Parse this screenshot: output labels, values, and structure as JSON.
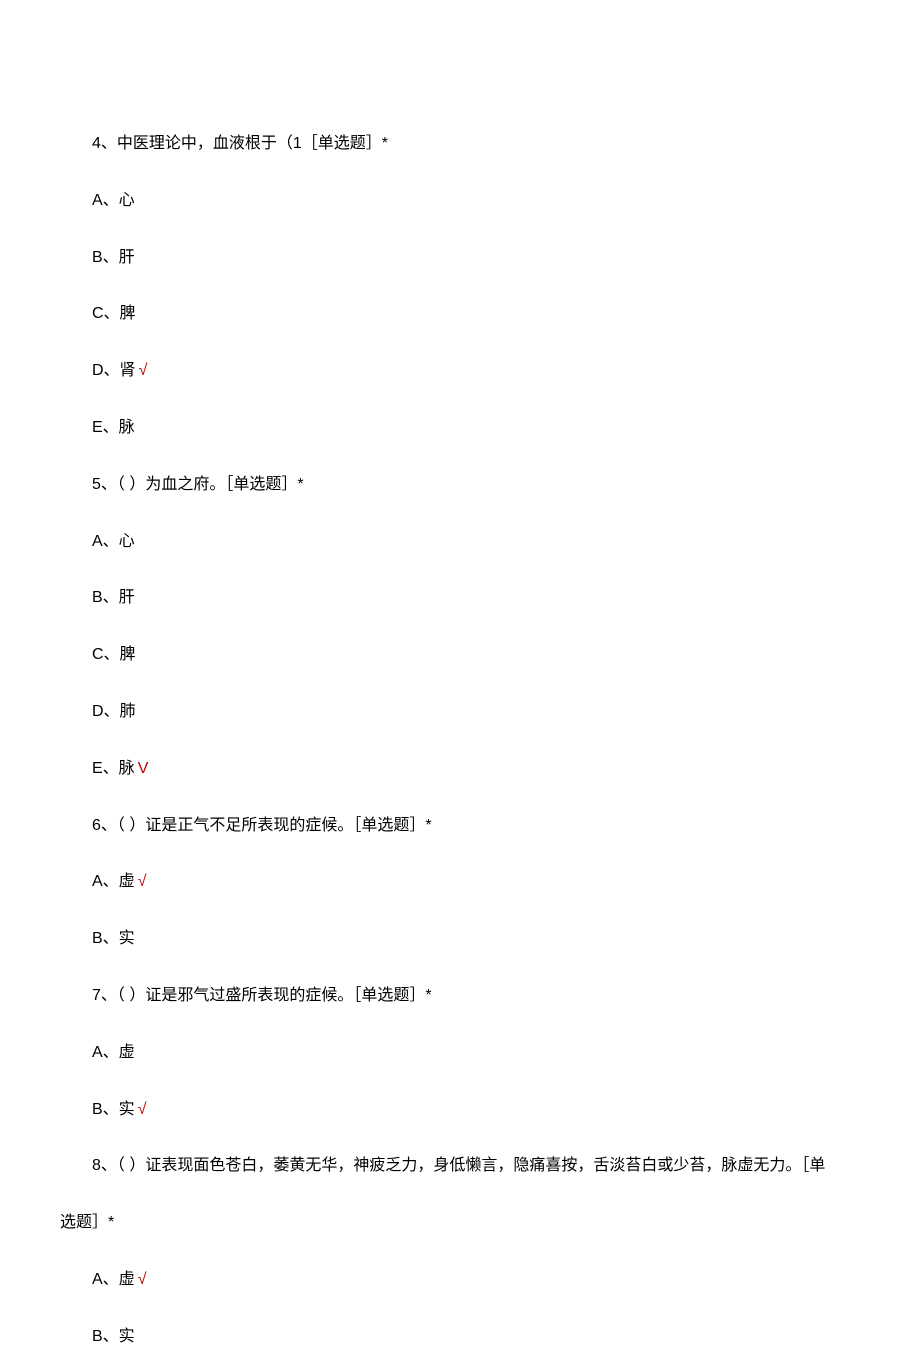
{
  "q4": {
    "stem": "4、中医理论中，血液根于（1［单选题］*",
    "a": "A、心",
    "b": "B、肝",
    "c": "C、脾",
    "d": "D、肾",
    "d_mark": "√",
    "e": "E、脉"
  },
  "q5": {
    "stem": "5、（ ）为血之府。［单选题］*",
    "a": "A、心",
    "b": "B、肝",
    "c": "C、脾",
    "d": "D、肺",
    "e": "E、脉",
    "e_mark": "V"
  },
  "q6": {
    "stem": "6、（ ）证是正气不足所表现的症候。［单选题］*",
    "a": "A、虚",
    "a_mark": "√",
    "b": "B、实"
  },
  "q7": {
    "stem": "7、（ ）证是邪气过盛所表现的症候。［单选题］*",
    "a": "A、虚",
    "b": "B、实",
    "b_mark": "√"
  },
  "q8": {
    "stem_part1": "8、（ ）证表现面色苍白，萎黄无华，神疲乏力，身低懒言，隐痛喜按，舌淡苔白或少苔，脉虚无力。［单",
    "stem_part2": "选题］*",
    "a": "A、虚",
    "a_mark": "√",
    "b": "B、实"
  }
}
